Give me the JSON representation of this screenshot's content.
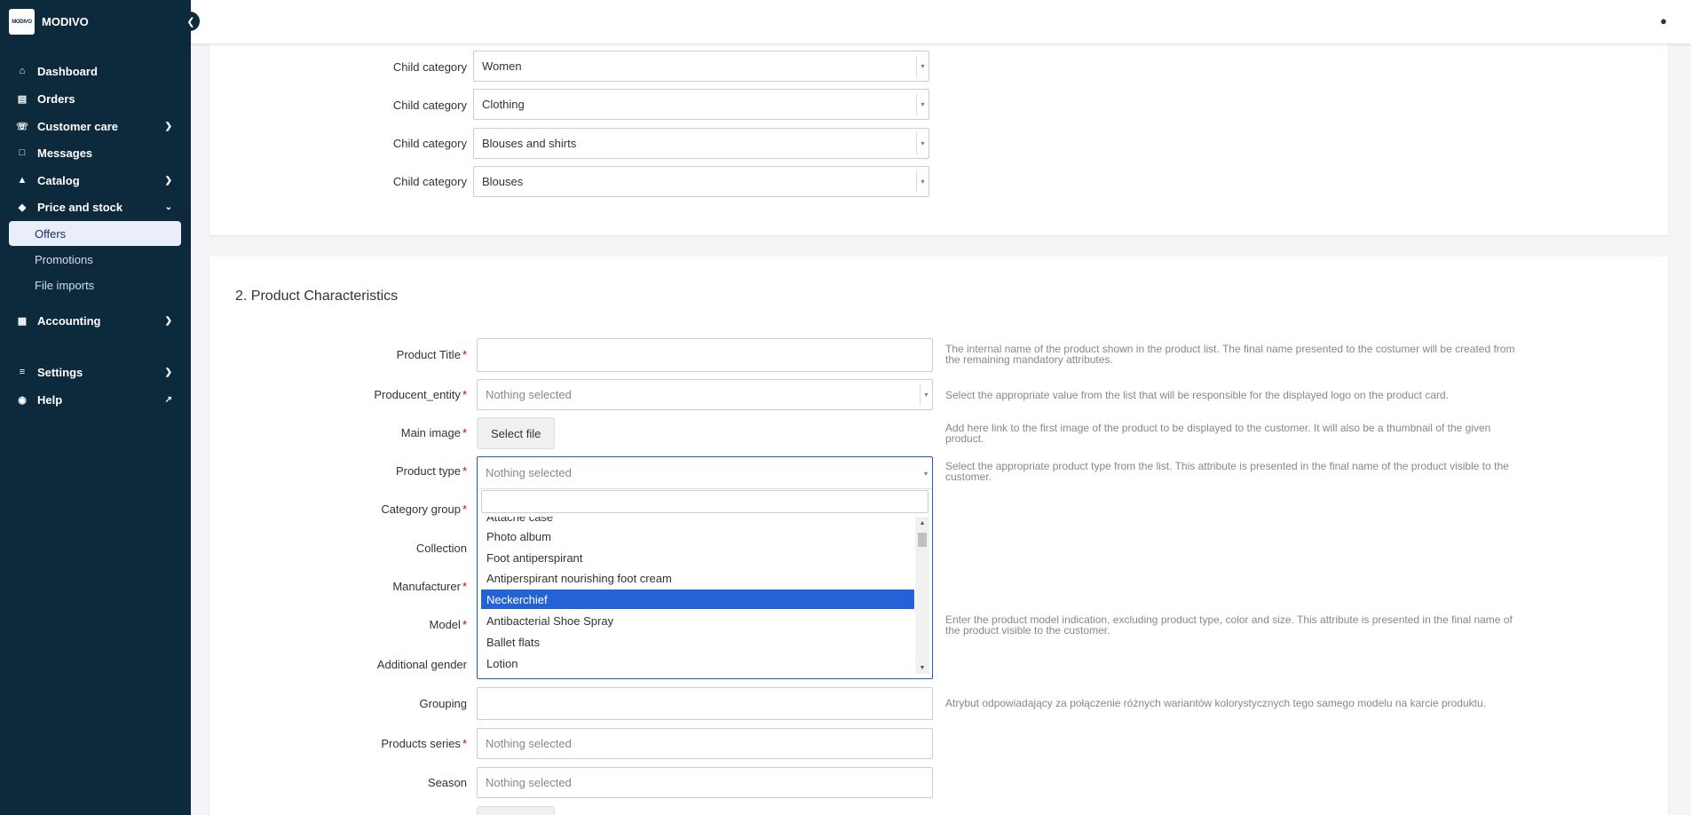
{
  "brand": {
    "logo_text": "MODIVO",
    "name": "MODIVO"
  },
  "nav": {
    "items": [
      {
        "label": "Dashboard",
        "icon": "home-icon"
      },
      {
        "label": "Orders",
        "icon": "clipboard-icon"
      },
      {
        "label": "Customer care",
        "icon": "headset-icon"
      },
      {
        "label": "Messages",
        "icon": "chat-icon"
      },
      {
        "label": "Catalog",
        "icon": "shapes-icon"
      },
      {
        "label": "Price and stock",
        "icon": "tag-icon"
      },
      {
        "label": "Accounting",
        "icon": "document-dollar-icon"
      },
      {
        "label": "Settings",
        "icon": "sliders-icon"
      },
      {
        "label": "Help",
        "icon": "lifebuoy-icon"
      }
    ],
    "sub_items": [
      "Offers",
      "Promotions",
      "File imports"
    ],
    "active_sub_item": "Offers"
  },
  "categories": {
    "rows": [
      {
        "label": "Child category",
        "value": "Women"
      },
      {
        "label": "Child category",
        "value": "Clothing"
      },
      {
        "label": "Child category",
        "value": "Blouses and shirts"
      },
      {
        "label": "Child category",
        "value": "Blouses"
      }
    ]
  },
  "characteristics": {
    "title": "2. Product Characteristics",
    "product_title": {
      "label": "Product Title",
      "help": "The internal name of the product shown in the product list. The final name presented to the costumer will be created from the remaining mandatory attributes."
    },
    "producent_entity": {
      "label": "Producent_entity",
      "placeholder": "Nothing selected",
      "help": "Select the appropriate value from the list that will be responsible for the displayed logo on the product card."
    },
    "main_image": {
      "label": "Main image",
      "button": "Select file",
      "help": "Add here link to the first image of the product to be displayed to the customer. It will also be a thumbnail of the given product."
    },
    "product_type": {
      "label": "Product type",
      "placeholder": "Nothing selected",
      "help": "Select the appropriate product type from the list. This attribute is presented in the final name of the product visible to the customer.",
      "options": [
        "Attache case",
        "Photo album",
        "Foot antiperspirant",
        "Antiperspirant nourishing foot cream",
        "Neckerchief",
        "Antibacterial Shoe Spray",
        "Ballet flats",
        "Lotion"
      ],
      "highlighted": "Neckerchief"
    },
    "category_group": {
      "label": "Category group"
    },
    "collection": {
      "label": "Collection"
    },
    "manufacturer": {
      "label": "Manufacturer"
    },
    "model": {
      "label": "Model",
      "help": "Enter the product model indication, excluding product type, color and size. This attribute is presented in the final name of the product visible to the customer."
    },
    "additional_gender": {
      "label": "Additional gender"
    },
    "grouping": {
      "label": "Grouping",
      "help": "Atrybut odpowiadający za połączenie różnych wariantów kolorystycznych tego samego modelu na karcie produktu."
    },
    "products_series": {
      "label": "Products series",
      "placeholder": "Nothing selected"
    },
    "season": {
      "label": "Season",
      "placeholder": "Nothing selected"
    },
    "required_mark": "*"
  }
}
